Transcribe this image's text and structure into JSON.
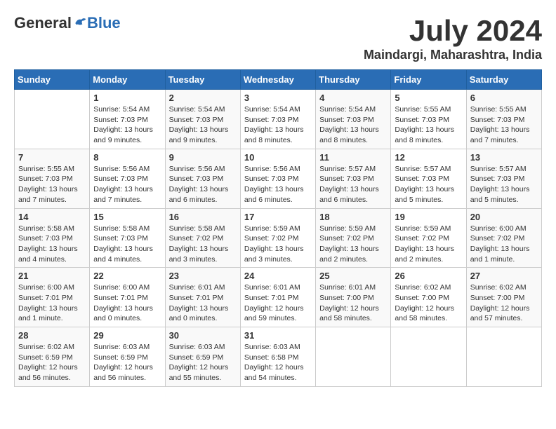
{
  "header": {
    "logo_general": "General",
    "logo_blue": "Blue",
    "month": "July 2024",
    "location": "Maindargi, Maharashtra, India"
  },
  "weekdays": [
    "Sunday",
    "Monday",
    "Tuesday",
    "Wednesday",
    "Thursday",
    "Friday",
    "Saturday"
  ],
  "weeks": [
    [
      {
        "day": "",
        "info": ""
      },
      {
        "day": "1",
        "info": "Sunrise: 5:54 AM\nSunset: 7:03 PM\nDaylight: 13 hours\nand 9 minutes."
      },
      {
        "day": "2",
        "info": "Sunrise: 5:54 AM\nSunset: 7:03 PM\nDaylight: 13 hours\nand 9 minutes."
      },
      {
        "day": "3",
        "info": "Sunrise: 5:54 AM\nSunset: 7:03 PM\nDaylight: 13 hours\nand 8 minutes."
      },
      {
        "day": "4",
        "info": "Sunrise: 5:54 AM\nSunset: 7:03 PM\nDaylight: 13 hours\nand 8 minutes."
      },
      {
        "day": "5",
        "info": "Sunrise: 5:55 AM\nSunset: 7:03 PM\nDaylight: 13 hours\nand 8 minutes."
      },
      {
        "day": "6",
        "info": "Sunrise: 5:55 AM\nSunset: 7:03 PM\nDaylight: 13 hours\nand 7 minutes."
      }
    ],
    [
      {
        "day": "7",
        "info": "Sunrise: 5:55 AM\nSunset: 7:03 PM\nDaylight: 13 hours\nand 7 minutes."
      },
      {
        "day": "8",
        "info": "Sunrise: 5:56 AM\nSunset: 7:03 PM\nDaylight: 13 hours\nand 7 minutes."
      },
      {
        "day": "9",
        "info": "Sunrise: 5:56 AM\nSunset: 7:03 PM\nDaylight: 13 hours\nand 6 minutes."
      },
      {
        "day": "10",
        "info": "Sunrise: 5:56 AM\nSunset: 7:03 PM\nDaylight: 13 hours\nand 6 minutes."
      },
      {
        "day": "11",
        "info": "Sunrise: 5:57 AM\nSunset: 7:03 PM\nDaylight: 13 hours\nand 6 minutes."
      },
      {
        "day": "12",
        "info": "Sunrise: 5:57 AM\nSunset: 7:03 PM\nDaylight: 13 hours\nand 5 minutes."
      },
      {
        "day": "13",
        "info": "Sunrise: 5:57 AM\nSunset: 7:03 PM\nDaylight: 13 hours\nand 5 minutes."
      }
    ],
    [
      {
        "day": "14",
        "info": "Sunrise: 5:58 AM\nSunset: 7:03 PM\nDaylight: 13 hours\nand 4 minutes."
      },
      {
        "day": "15",
        "info": "Sunrise: 5:58 AM\nSunset: 7:03 PM\nDaylight: 13 hours\nand 4 minutes."
      },
      {
        "day": "16",
        "info": "Sunrise: 5:58 AM\nSunset: 7:02 PM\nDaylight: 13 hours\nand 3 minutes."
      },
      {
        "day": "17",
        "info": "Sunrise: 5:59 AM\nSunset: 7:02 PM\nDaylight: 13 hours\nand 3 minutes."
      },
      {
        "day": "18",
        "info": "Sunrise: 5:59 AM\nSunset: 7:02 PM\nDaylight: 13 hours\nand 2 minutes."
      },
      {
        "day": "19",
        "info": "Sunrise: 5:59 AM\nSunset: 7:02 PM\nDaylight: 13 hours\nand 2 minutes."
      },
      {
        "day": "20",
        "info": "Sunrise: 6:00 AM\nSunset: 7:02 PM\nDaylight: 13 hours\nand 1 minute."
      }
    ],
    [
      {
        "day": "21",
        "info": "Sunrise: 6:00 AM\nSunset: 7:01 PM\nDaylight: 13 hours\nand 1 minute."
      },
      {
        "day": "22",
        "info": "Sunrise: 6:00 AM\nSunset: 7:01 PM\nDaylight: 13 hours\nand 0 minutes."
      },
      {
        "day": "23",
        "info": "Sunrise: 6:01 AM\nSunset: 7:01 PM\nDaylight: 13 hours\nand 0 minutes."
      },
      {
        "day": "24",
        "info": "Sunrise: 6:01 AM\nSunset: 7:01 PM\nDaylight: 12 hours\nand 59 minutes."
      },
      {
        "day": "25",
        "info": "Sunrise: 6:01 AM\nSunset: 7:00 PM\nDaylight: 12 hours\nand 58 minutes."
      },
      {
        "day": "26",
        "info": "Sunrise: 6:02 AM\nSunset: 7:00 PM\nDaylight: 12 hours\nand 58 minutes."
      },
      {
        "day": "27",
        "info": "Sunrise: 6:02 AM\nSunset: 7:00 PM\nDaylight: 12 hours\nand 57 minutes."
      }
    ],
    [
      {
        "day": "28",
        "info": "Sunrise: 6:02 AM\nSunset: 6:59 PM\nDaylight: 12 hours\nand 56 minutes."
      },
      {
        "day": "29",
        "info": "Sunrise: 6:03 AM\nSunset: 6:59 PM\nDaylight: 12 hours\nand 56 minutes."
      },
      {
        "day": "30",
        "info": "Sunrise: 6:03 AM\nSunset: 6:59 PM\nDaylight: 12 hours\nand 55 minutes."
      },
      {
        "day": "31",
        "info": "Sunrise: 6:03 AM\nSunset: 6:58 PM\nDaylight: 12 hours\nand 54 minutes."
      },
      {
        "day": "",
        "info": ""
      },
      {
        "day": "",
        "info": ""
      },
      {
        "day": "",
        "info": ""
      }
    ]
  ]
}
